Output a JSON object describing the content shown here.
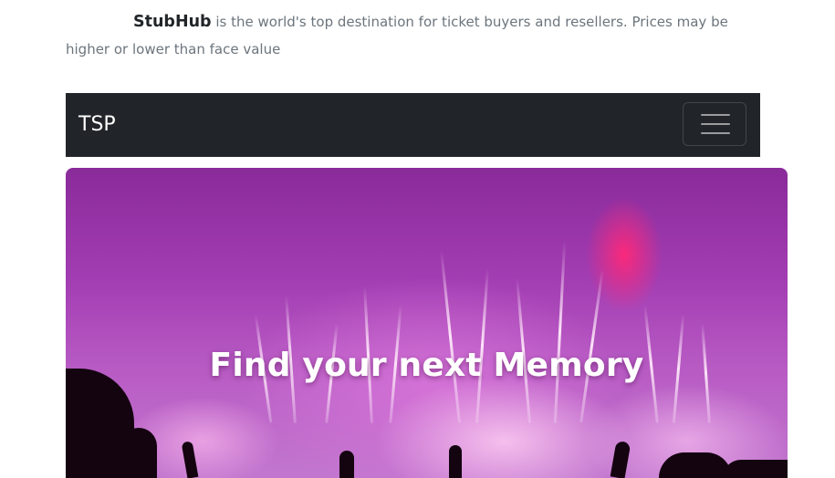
{
  "intro": {
    "brand": "StubHub",
    "text": " is the world's top destination for ticket buyers and resellers. Prices may be higher or lower than face value"
  },
  "navbar": {
    "brand": "TSP",
    "toggler_icon": "hamburger-menu-icon",
    "background": "#212529"
  },
  "hero": {
    "title": "Find your next Memory",
    "image": "concert-fireworks-image",
    "accent": "#a23cb2"
  }
}
